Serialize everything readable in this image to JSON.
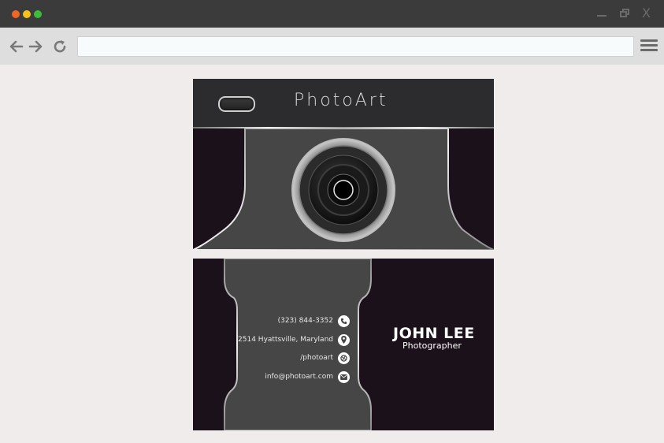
{
  "window": {
    "controls": [
      "minimize-icon",
      "restore-icon",
      "close-icon"
    ],
    "close_glyph": "X"
  },
  "toolbar": {
    "url_value": "",
    "icons": [
      "back-arrow-icon",
      "forward-arrow-icon",
      "reload-icon",
      "hamburger-menu-icon"
    ]
  },
  "card_front": {
    "brand": "PhotoArt"
  },
  "card_back": {
    "contacts": [
      {
        "text": "(323) 844-3352",
        "icon": "phone-icon"
      },
      {
        "text": "2514 Hyattsville, Maryland",
        "icon": "location-pin-icon"
      },
      {
        "text": "/photoart",
        "icon": "social-icon"
      },
      {
        "text": "info@photoart.com",
        "icon": "mail-icon"
      }
    ],
    "name": "JOHN LEE",
    "title": "Photographer"
  },
  "colors": {
    "titlebar": "#3b3b3b",
    "toolbar": "#dedede",
    "page_bg": "#f0eceb",
    "card_dark": "#1b111a",
    "card_panel": "#464646",
    "traffic_red": "#f26522",
    "traffic_yellow": "#f5c21b",
    "traffic_green": "#3dbb3d"
  }
}
